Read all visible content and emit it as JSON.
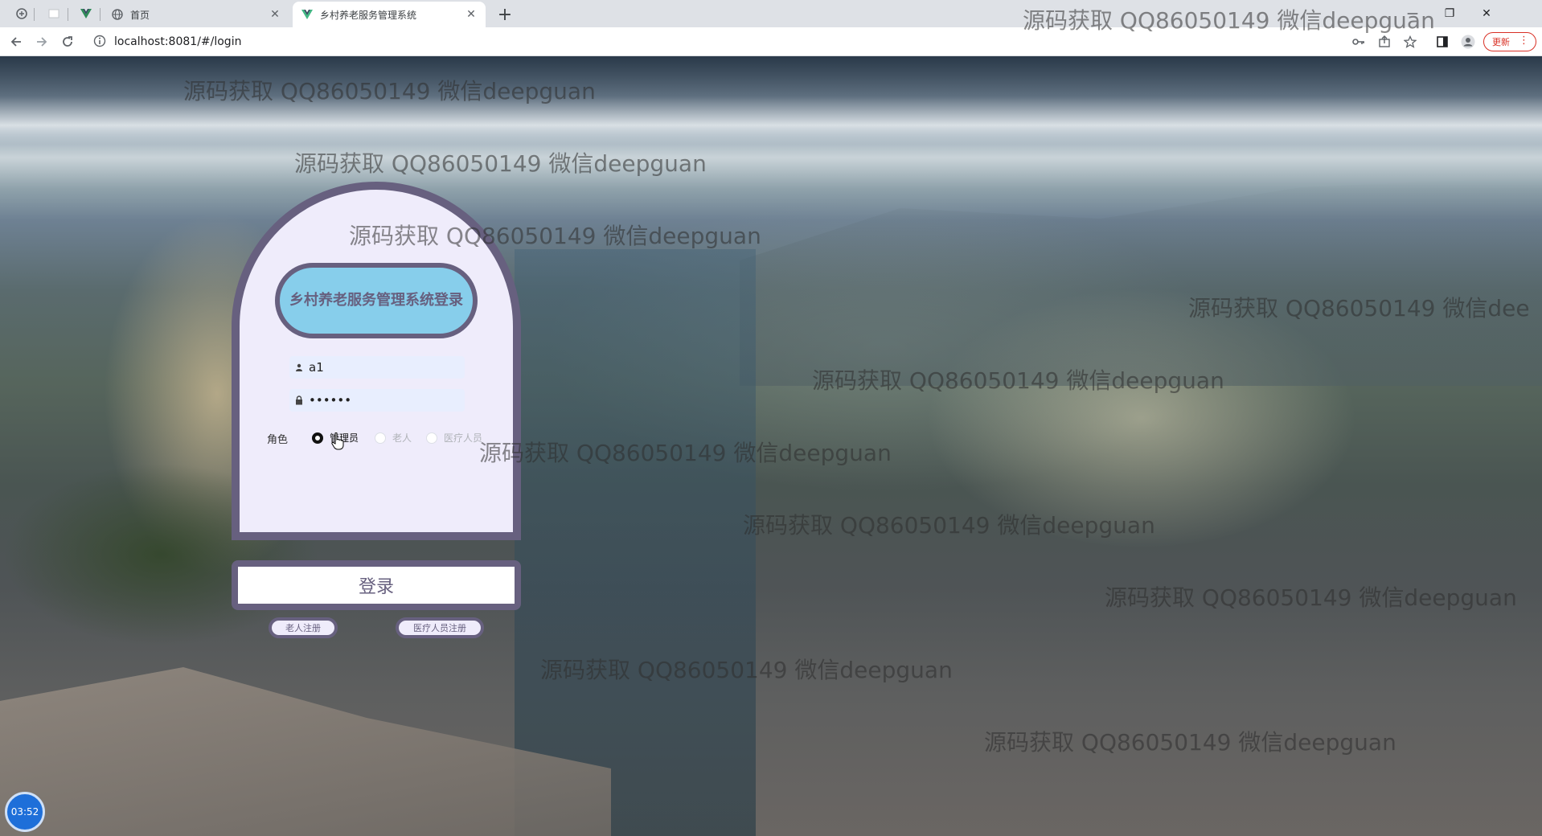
{
  "browser": {
    "tabs": [
      {
        "title": "首页",
        "active": false
      },
      {
        "title": "乡村养老服务管理系统",
        "active": true
      }
    ],
    "url": "localhost:8081/#/login",
    "update_label": "更新",
    "new_tab_label": "+"
  },
  "watermarks": [
    "源码获取 QQ86050149 微信deepguan",
    "源码获取 QQ86050149 微信deepguan",
    "源码获取 QQ86050149 微信deepguan",
    "源码获取 QQ86050149 微信deepguan",
    "源码获取 QQ86050149 微信deepguan",
    "源码获取 QQ86050149 微信dee",
    "源码获取 QQ86050149 微信deepguan",
    "源码获取 QQ86050149 微信deepguan",
    "源码获取 QQ86050149 微信deepguan",
    "源码获取 QQ86050149 微信deepguan",
    "源码获取 QQ86050149 微信deepguan"
  ],
  "login": {
    "title": "乡村养老服务管理系统登录",
    "username": "a1",
    "password": "••••••",
    "role_label": "角色",
    "roles": [
      {
        "label": "管理员",
        "checked": true
      },
      {
        "label": "老人",
        "checked": false
      },
      {
        "label": "医疗人员",
        "checked": false
      }
    ],
    "submit_label": "登录",
    "register_elder_label": "老人注册",
    "register_medical_label": "医疗人员注册"
  },
  "clock": "03:52",
  "colors": {
    "card_border": "#67607f",
    "card_bg": "#efecfb",
    "title_bg": "#87ceeb"
  }
}
